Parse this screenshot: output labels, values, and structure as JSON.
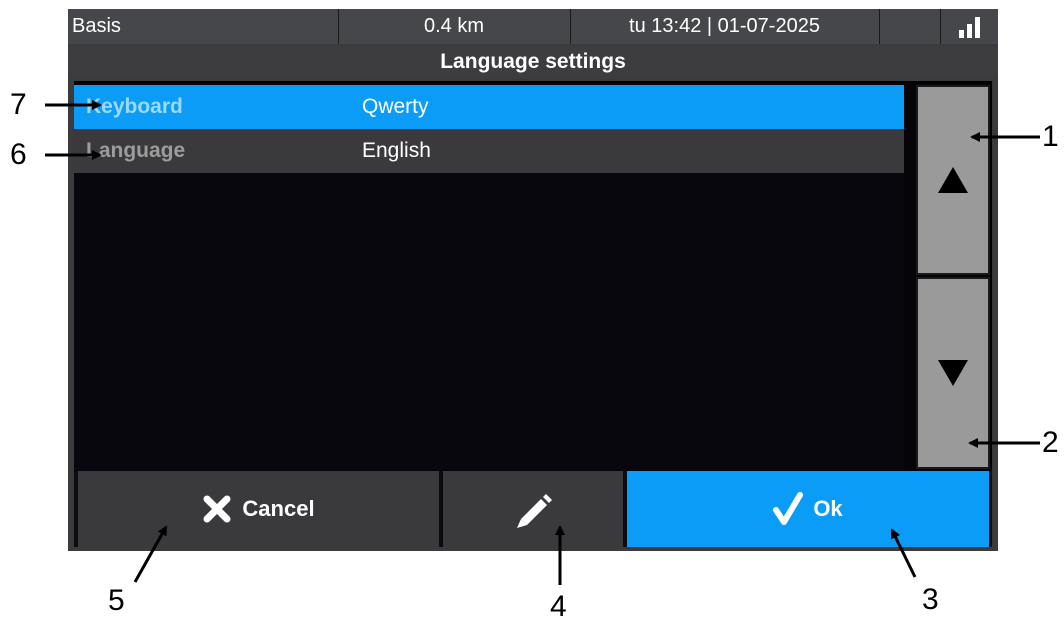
{
  "status_bar": {
    "profile": "Basis",
    "distance": "0.4 km",
    "datetime": "tu 13:42 | 01-07-2025"
  },
  "screen": {
    "title": "Language settings"
  },
  "settings_list": {
    "rows": [
      {
        "label": "Keyboard",
        "value": "Qwerty",
        "selected": true
      },
      {
        "label": "Language",
        "value": "English",
        "selected": false
      }
    ]
  },
  "buttons": {
    "cancel_label": "Cancel",
    "ok_label": "Ok"
  },
  "icons": {
    "scroll_up": "triangle-up-icon",
    "scroll_down": "triangle-down-icon",
    "cancel": "x-icon",
    "edit": "pencil-icon",
    "ok": "check-icon",
    "signal": "signal-strength-icon"
  },
  "colors": {
    "accent_blue": "#0a9cf7",
    "panel_dark": "#3a3a3d",
    "scroll_gray": "#9a9a9a"
  },
  "callouts": {
    "c1": "1",
    "c2": "2",
    "c3": "3",
    "c4": "4",
    "c5": "5",
    "c6": "6",
    "c7": "7"
  }
}
